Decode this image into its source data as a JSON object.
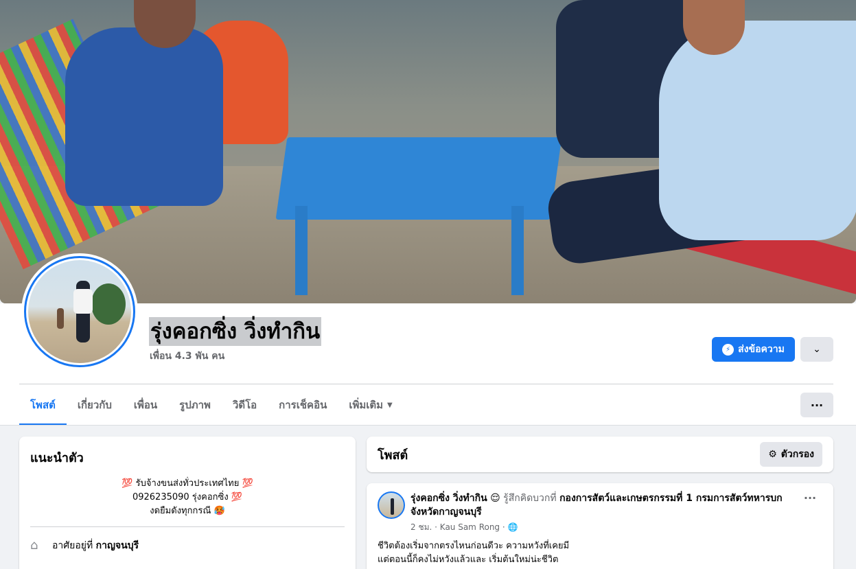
{
  "profile": {
    "name": "รุ่งคอกซิ่ง วิ่งทำกิน",
    "friends": "เพื่อน 4.3 พัน คน"
  },
  "actions": {
    "message_label": "ส่งข้อความ",
    "message_icon": "messenger-icon",
    "chevron_icon": "chevron-down-icon",
    "more_icon": "more-dots-icon"
  },
  "tabs": [
    {
      "label": "โพสต์",
      "active": true
    },
    {
      "label": "เกี่ยวกับ"
    },
    {
      "label": "เพื่อน"
    },
    {
      "label": "รูปภาพ"
    },
    {
      "label": "วิดีโอ"
    },
    {
      "label": "การเช็คอิน"
    },
    {
      "label": "เพิ่มเติม"
    }
  ],
  "intro": {
    "title": "แนะนำตัว",
    "bio": [
      "💯 รับจ้างขนส่งทั่วประเทศไทย 💯",
      "0926235090 รุ่งคอกซิ่ง 💯",
      "งดยืมดังทุกกรณี 🥵"
    ],
    "lives_in_prefix": "อาศัยอยู่ที่",
    "lives_in_place": "กาญจนบุรี"
  },
  "posts": {
    "title": "โพสต์",
    "filter_label": "ตัวกรอง",
    "items": [
      {
        "author": "รุ่งคอกซิ่ง วิ่งทำกิน",
        "emoji": "😌",
        "feeling": "รู้สึกคิดบวกที่",
        "place": "กองการสัตว์และเกษตรกรรมที่ 1 กรมการสัตว์ทหารบก จังหวัดกาญจนบุรี",
        "time": "2 ชม.",
        "location": "Kau Sam Rong",
        "text_line1": "ชีวิตต้องเริ่มจากตรงไหนก่อนดีวะ ความหวังที่เคยมี",
        "text_line2": "แต่ตอนนี้ก็คงไม่หวังแล้วและ เริ่มต้นใหม่น่ะชีวิต"
      }
    ]
  },
  "colors": {
    "accent": "#1877f2",
    "background": "#f0f2f5",
    "secondary_text": "#65676b"
  }
}
